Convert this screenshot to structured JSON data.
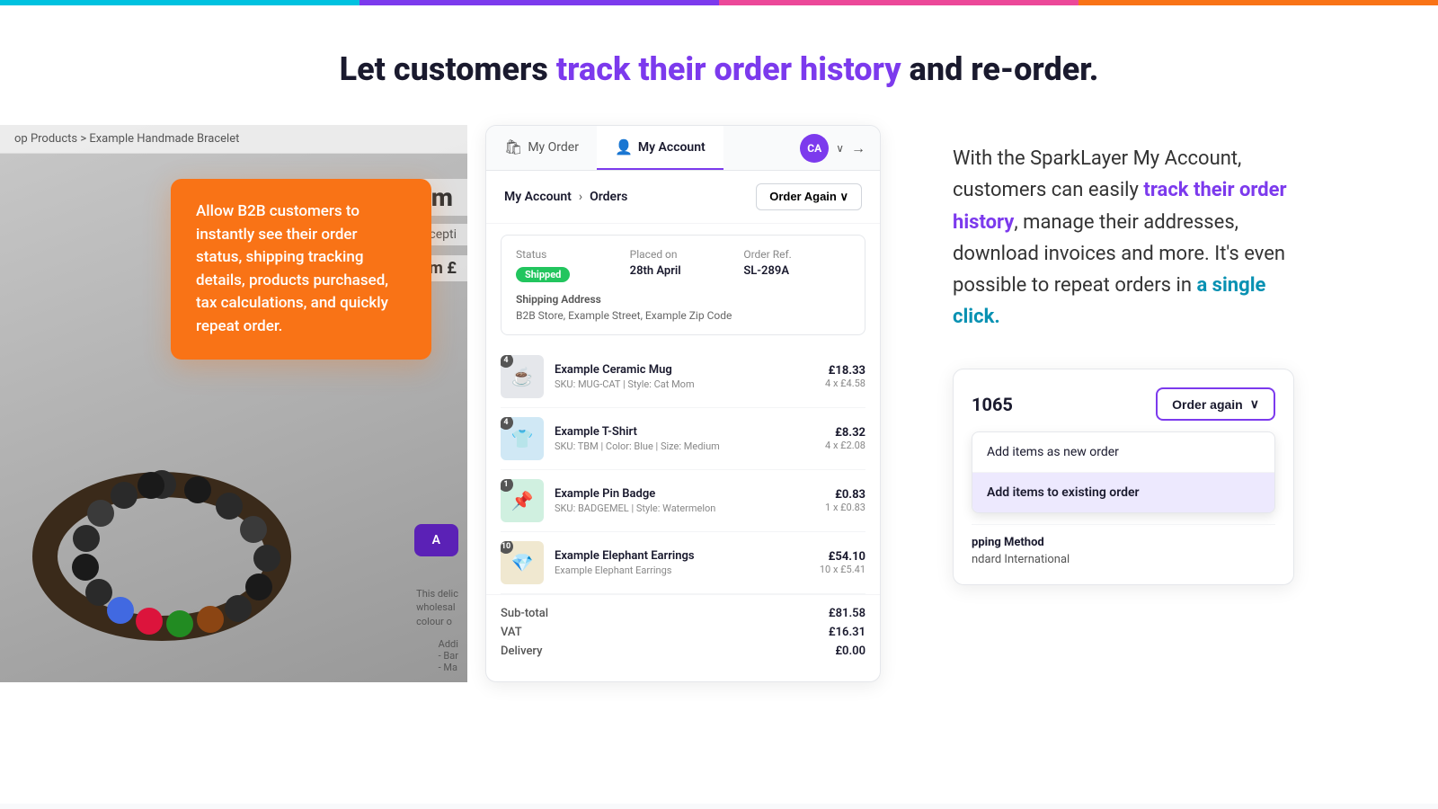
{
  "topBar": {
    "segments": [
      "cyan",
      "purple",
      "pink",
      "orange"
    ]
  },
  "heroHeading": {
    "prefix": "Let customers ",
    "highlight": "track their order history",
    "suffix": " and re-order."
  },
  "leftPanel": {
    "breadcrumb": "op Products > Example Handmade Bracelet",
    "productName": "xam",
    "acceptText": "cepti",
    "fromText": "om £",
    "addToCartLabel": "A",
    "descriptionLines": [
      "This delic",
      "wholesal",
      "colour o"
    ],
    "additionalInfo": [
      "Addi",
      "- Bar",
      "- Ma"
    ]
  },
  "tooltip": {
    "text": "Allow B2B customers to instantly see their order status, shipping tracking details, products purchased, tax calculations, and quickly repeat order."
  },
  "centerPanel": {
    "nav": {
      "myOrderLabel": "My Order",
      "myAccountLabel": "My Account",
      "avatarText": "CA"
    },
    "breadcrumb": {
      "parentLabel": "My Account",
      "separator": "›",
      "currentLabel": "Orders"
    },
    "orderAgainButton": "Order Again ∨",
    "orderInfo": {
      "statusLabel": "Status",
      "statusValue": "Shipped",
      "placedOnLabel": "Placed on",
      "placedOnValue": "28th April",
      "orderRefLabel": "Order Ref.",
      "orderRefValue": "SL-289A",
      "shippingLabel": "Shipping Address",
      "shippingAddress": "B2B Store, Example Street, Example Zip Code"
    },
    "products": [
      {
        "badge": "4",
        "emoji": "☕",
        "name": "Example Ceramic Mug",
        "sku": "SKU: MUG-CAT | Style: Cat Mom",
        "totalPrice": "£18.33",
        "unitPrice": "4 x £4.58"
      },
      {
        "badge": "4",
        "emoji": "👕",
        "name": "Example T-Shirt",
        "sku": "SKU: TBM | Color: Blue | Size: Medium",
        "totalPrice": "£8.32",
        "unitPrice": "4 x £2.08"
      },
      {
        "badge": "1",
        "emoji": "📌",
        "name": "Example Pin Badge",
        "sku": "SKU: BADGEMEL | Style: Watermelon",
        "totalPrice": "£0.83",
        "unitPrice": "1 x £0.83"
      },
      {
        "badge": "10",
        "emoji": "💎",
        "name": "Example Elephant Earrings",
        "sku": "Example Elephant Earrings",
        "totalPrice": "£54.10",
        "unitPrice": "10 x £5.41"
      }
    ],
    "totals": {
      "subTotalLabel": "Sub-total",
      "subTotalValue": "£81.58",
      "vatLabel": "VAT",
      "vatValue": "£16.31",
      "deliveryLabel": "Delivery",
      "deliveryValue": "£0.00"
    }
  },
  "rightPanel": {
    "description": {
      "prefix": "With the SparkLayer My Account, customers can easily ",
      "highlight1": "track their order history",
      "middle": ", manage their addresses, download invoices and more. It's even possible to repeat orders in ",
      "highlight2": "a single click.",
      "suffix": ""
    },
    "orderAgainSection": {
      "orderNumber": "1065",
      "buttonLabel": "Order again",
      "chevron": "∨"
    },
    "dropdownItems": [
      {
        "label": "Add items as new order",
        "highlighted": false
      },
      {
        "label": "Add items to existing order",
        "highlighted": true
      }
    ],
    "shippingMethod": {
      "label": "pping Method",
      "value": "ndard International"
    }
  }
}
